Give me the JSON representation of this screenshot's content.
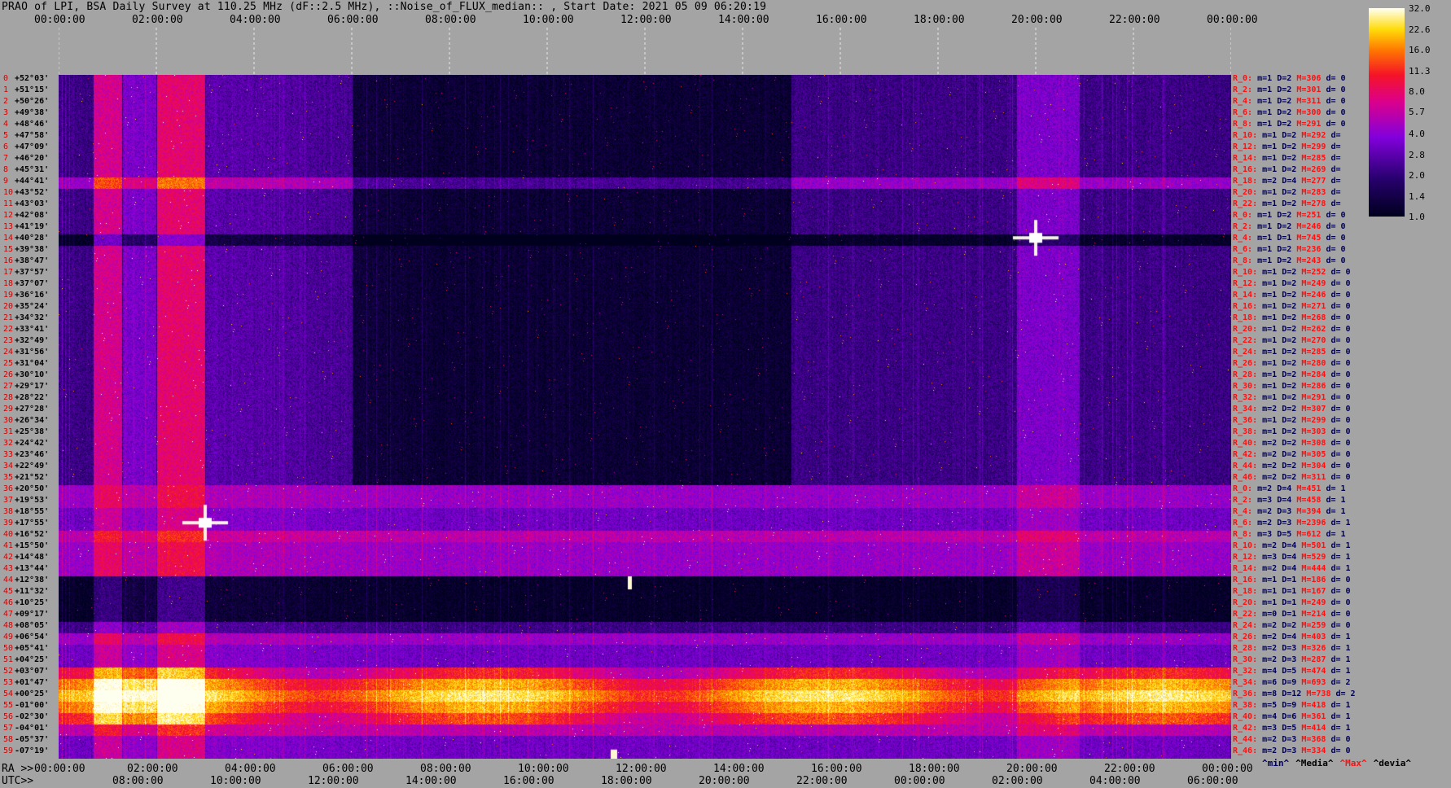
{
  "title": "PRAO of LPI, BSA Daily Survey at 110.25 MHz (dF::2.5 MHz), ::Noise_of_FLUX_median:: , Start Date: 2021 05 09 06:20:19",
  "chart_data": {
    "type": "heatmap",
    "title": "PRAO of LPI, BSA Daily Survey at 110.25 MHz (dF::2.5 MHz), ::Noise_of_FLUX_median:: , Start Date: 2021 05 09 06:20:19",
    "x_top_ticks": [
      "00:00:00",
      "02:00:00",
      "04:00:00",
      "06:00:00",
      "08:00:00",
      "10:00:00",
      "12:00:00",
      "14:00:00",
      "16:00:00",
      "18:00:00",
      "20:00:00",
      "22:00:00",
      "00:00:00"
    ],
    "x_bottom_prefix": "RA >>",
    "x_bottom_ticks": [
      "00:00:00",
      "02:00:00",
      "04:00:00",
      "06:00:00",
      "08:00:00",
      "10:00:00",
      "12:00:00",
      "14:00:00",
      "16:00:00",
      "18:00:00",
      "20:00:00",
      "22:00:00",
      "00:00:00"
    ],
    "x_utc_prefix": "UTC>>",
    "x_utc_ticks": [
      "08:00:00",
      "10:00:00",
      "12:00:00",
      "14:00:00",
      "16:00:00",
      "18:00:00",
      "20:00:00",
      "22:00:00",
      "00:00:00",
      "02:00:00",
      "04:00:00",
      "06:00:00"
    ],
    "colorbar_ticks": [
      "32.0",
      "22.6",
      "16.0",
      "11.3",
      "8.0",
      "5.7",
      "4.0",
      "2.8",
      "2.0",
      "1.4",
      "1.0"
    ],
    "colorbar_range": [
      1.0,
      32.0
    ],
    "colorbar_scale": "log",
    "stat_legend": [
      "^min^",
      "^Media^",
      "^Max^",
      "^devia^"
    ],
    "stat_legend_colors": [
      "#000055",
      "#000000",
      "#ff1010",
      "#000000"
    ],
    "beams": [
      {
        "n": "0",
        "dec": "+52°03'",
        "r": "R_0:",
        "m": "m=1",
        "d": "D=2",
        "M": "M=306",
        "dv": "d= 0"
      },
      {
        "n": "1",
        "dec": "+51°15'",
        "r": "R_2:",
        "m": "m=1",
        "d": "D=2",
        "M": "M=301",
        "dv": "d= 0"
      },
      {
        "n": "2",
        "dec": "+50°26'",
        "r": "R_4:",
        "m": "m=1",
        "d": "D=2",
        "M": "M=311",
        "dv": "d= 0"
      },
      {
        "n": "3",
        "dec": "+49°38'",
        "r": "R_6:",
        "m": "m=1",
        "d": "D=2",
        "M": "M=300",
        "dv": "d= 0"
      },
      {
        "n": "4",
        "dec": "+48°46'",
        "r": "R_8:",
        "m": "m=1",
        "d": "D=2",
        "M": "M=291",
        "dv": "d= 0"
      },
      {
        "n": "5",
        "dec": "+47°58'",
        "r": "R_10:",
        "m": "m=1",
        "d": "D=2",
        "M": "M=292",
        "dv": "d="
      },
      {
        "n": "6",
        "dec": "+47°09'",
        "r": "R_12:",
        "m": "m=1",
        "d": "D=2",
        "M": "M=299",
        "dv": "d="
      },
      {
        "n": "7",
        "dec": "+46°20'",
        "r": "R_14:",
        "m": "m=1",
        "d": "D=2",
        "M": "M=285",
        "dv": "d="
      },
      {
        "n": "8",
        "dec": "+45°31'",
        "r": "R_16:",
        "m": "m=1",
        "d": "D=2",
        "M": "M=269",
        "dv": "d="
      },
      {
        "n": "9",
        "dec": "+44°41'",
        "r": "R_18:",
        "m": "m=2",
        "d": "D=4",
        "M": "M=277",
        "dv": "d="
      },
      {
        "n": "10",
        "dec": "+43°52'",
        "r": "R_20:",
        "m": "m=1",
        "d": "D=2",
        "M": "M=283",
        "dv": "d="
      },
      {
        "n": "11",
        "dec": "+43°03'",
        "r": "R_22:",
        "m": "m=1",
        "d": "D=2",
        "M": "M=278",
        "dv": "d="
      },
      {
        "n": "12",
        "dec": "+42°08'",
        "r": "R_0:",
        "m": "m=1",
        "d": "D=2",
        "M": "M=251",
        "dv": "d= 0"
      },
      {
        "n": "13",
        "dec": "+41°19'",
        "r": "R_2:",
        "m": "m=1",
        "d": "D=2",
        "M": "M=246",
        "dv": "d= 0"
      },
      {
        "n": "14",
        "dec": "+40°28'",
        "r": "R_4:",
        "m": "m=1",
        "d": "D=1",
        "M": "M=745",
        "dv": "d= 0"
      },
      {
        "n": "15",
        "dec": "+39°38'",
        "r": "R_6:",
        "m": "m=1",
        "d": "D=2",
        "M": "M=236",
        "dv": "d= 0"
      },
      {
        "n": "16",
        "dec": "+38°47'",
        "r": "R_8:",
        "m": "m=1",
        "d": "D=2",
        "M": "M=243",
        "dv": "d= 0"
      },
      {
        "n": "17",
        "dec": "+37°57'",
        "r": "R_10:",
        "m": "m=1",
        "d": "D=2",
        "M": "M=252",
        "dv": "d= 0"
      },
      {
        "n": "18",
        "dec": "+37°07'",
        "r": "R_12:",
        "m": "m=1",
        "d": "D=2",
        "M": "M=249",
        "dv": "d= 0"
      },
      {
        "n": "19",
        "dec": "+36°16'",
        "r": "R_14:",
        "m": "m=1",
        "d": "D=2",
        "M": "M=246",
        "dv": "d= 0"
      },
      {
        "n": "20",
        "dec": "+35°24'",
        "r": "R_16:",
        "m": "m=1",
        "d": "D=2",
        "M": "M=271",
        "dv": "d= 0"
      },
      {
        "n": "21",
        "dec": "+34°32'",
        "r": "R_18:",
        "m": "m=1",
        "d": "D=2",
        "M": "M=268",
        "dv": "d= 0"
      },
      {
        "n": "22",
        "dec": "+33°41'",
        "r": "R_20:",
        "m": "m=1",
        "d": "D=2",
        "M": "M=262",
        "dv": "d= 0"
      },
      {
        "n": "23",
        "dec": "+32°49'",
        "r": "R_22:",
        "m": "m=1",
        "d": "D=2",
        "M": "M=270",
        "dv": "d= 0"
      },
      {
        "n": "24",
        "dec": "+31°56'",
        "r": "R_24:",
        "m": "m=1",
        "d": "D=2",
        "M": "M=285",
        "dv": "d= 0"
      },
      {
        "n": "25",
        "dec": "+31°04'",
        "r": "R_26:",
        "m": "m=1",
        "d": "D=2",
        "M": "M=280",
        "dv": "d= 0"
      },
      {
        "n": "26",
        "dec": "+30°10'",
        "r": "R_28:",
        "m": "m=1",
        "d": "D=2",
        "M": "M=284",
        "dv": "d= 0"
      },
      {
        "n": "27",
        "dec": "+29°17'",
        "r": "R_30:",
        "m": "m=1",
        "d": "D=2",
        "M": "M=286",
        "dv": "d= 0"
      },
      {
        "n": "28",
        "dec": "+28°22'",
        "r": "R_32:",
        "m": "m=1",
        "d": "D=2",
        "M": "M=291",
        "dv": "d= 0"
      },
      {
        "n": "29",
        "dec": "+27°28'",
        "r": "R_34:",
        "m": "m=2",
        "d": "D=2",
        "M": "M=307",
        "dv": "d= 0"
      },
      {
        "n": "30",
        "dec": "+26°34'",
        "r": "R_36:",
        "m": "m=1",
        "d": "D=2",
        "M": "M=299",
        "dv": "d= 0"
      },
      {
        "n": "31",
        "dec": "+25°38'",
        "r": "R_38:",
        "m": "m=1",
        "d": "D=2",
        "M": "M=303",
        "dv": "d= 0"
      },
      {
        "n": "32",
        "dec": "+24°42'",
        "r": "R_40:",
        "m": "m=2",
        "d": "D=2",
        "M": "M=308",
        "dv": "d= 0"
      },
      {
        "n": "33",
        "dec": "+23°46'",
        "r": "R_42:",
        "m": "m=2",
        "d": "D=2",
        "M": "M=305",
        "dv": "d= 0"
      },
      {
        "n": "34",
        "dec": "+22°49'",
        "r": "R_44:",
        "m": "m=2",
        "d": "D=2",
        "M": "M=304",
        "dv": "d= 0"
      },
      {
        "n": "35",
        "dec": "+21°52'",
        "r": "R_46:",
        "m": "m=2",
        "d": "D=2",
        "M": "M=311",
        "dv": "d= 0"
      },
      {
        "n": "36",
        "dec": "+20°50'",
        "r": "R_0:",
        "m": "m=2",
        "d": "D=4",
        "M": "M=451",
        "dv": "d= 1"
      },
      {
        "n": "37",
        "dec": "+19°53'",
        "r": "R_2:",
        "m": "m=3",
        "d": "D=4",
        "M": "M=458",
        "dv": "d= 1"
      },
      {
        "n": "38",
        "dec": "+18°55'",
        "r": "R_4:",
        "m": "m=2",
        "d": "D=3",
        "M": "M=394",
        "dv": "d= 1"
      },
      {
        "n": "39",
        "dec": "+17°55'",
        "r": "R_6:",
        "m": "m=2",
        "d": "D=3",
        "M": "M=2396",
        "dv": "d= 1"
      },
      {
        "n": "40",
        "dec": "+16°52'",
        "r": "R_8:",
        "m": "m=3",
        "d": "D=5",
        "M": "M=612",
        "dv": "d= 1"
      },
      {
        "n": "41",
        "dec": "+15°50'",
        "r": "R_10:",
        "m": "m=2",
        "d": "D=4",
        "M": "M=501",
        "dv": "d= 1"
      },
      {
        "n": "42",
        "dec": "+14°48'",
        "r": "R_12:",
        "m": "m=3",
        "d": "D=4",
        "M": "M=529",
        "dv": "d= 1"
      },
      {
        "n": "43",
        "dec": "+13°44'",
        "r": "R_14:",
        "m": "m=2",
        "d": "D=4",
        "M": "M=444",
        "dv": "d= 1"
      },
      {
        "n": "44",
        "dec": "+12°38'",
        "r": "R_16:",
        "m": "m=1",
        "d": "D=1",
        "M": "M=186",
        "dv": "d= 0"
      },
      {
        "n": "45",
        "dec": "+11°32'",
        "r": "R_18:",
        "m": "m=1",
        "d": "D=1",
        "M": "M=167",
        "dv": "d= 0"
      },
      {
        "n": "46",
        "dec": "+10°25'",
        "r": "R_20:",
        "m": "m=1",
        "d": "D=1",
        "M": "M=249",
        "dv": "d= 0"
      },
      {
        "n": "47",
        "dec": "+09°17'",
        "r": "R_22:",
        "m": "m=0",
        "d": "D=1",
        "M": "M=214",
        "dv": "d= 0"
      },
      {
        "n": "48",
        "dec": "+08°05'",
        "r": "R_24:",
        "m": "m=2",
        "d": "D=2",
        "M": "M=259",
        "dv": "d= 0"
      },
      {
        "n": "49",
        "dec": "+06°54'",
        "r": "R_26:",
        "m": "m=2",
        "d": "D=4",
        "M": "M=403",
        "dv": "d= 1"
      },
      {
        "n": "50",
        "dec": "+05°41'",
        "r": "R_28:",
        "m": "m=2",
        "d": "D=3",
        "M": "M=326",
        "dv": "d= 1"
      },
      {
        "n": "51",
        "dec": "+04°25'",
        "r": "R_30:",
        "m": "m=2",
        "d": "D=3",
        "M": "M=287",
        "dv": "d= 1"
      },
      {
        "n": "52",
        "dec": "+03°07'",
        "r": "R_32:",
        "m": "m=4",
        "d": "D=5",
        "M": "M=474",
        "dv": "d= 1"
      },
      {
        "n": "53",
        "dec": "+01°47'",
        "r": "R_34:",
        "m": "m=6",
        "d": "D=9",
        "M": "M=693",
        "dv": "d= 2"
      },
      {
        "n": "54",
        "dec": "+00°25'",
        "r": "R_36:",
        "m": "m=8",
        "d": "D=12",
        "M": "M=738",
        "dv": "d= 2"
      },
      {
        "n": "55",
        "dec": "-01°00'",
        "r": "R_38:",
        "m": "m=5",
        "d": "D=9",
        "M": "M=418",
        "dv": "d= 1"
      },
      {
        "n": "56",
        "dec": "-02°30'",
        "r": "R_40:",
        "m": "m=4",
        "d": "D=6",
        "M": "M=361",
        "dv": "d= 1"
      },
      {
        "n": "57",
        "dec": "-04°01'",
        "r": "R_42:",
        "m": "m=3",
        "d": "D=5",
        "M": "M=414",
        "dv": "d= 1"
      },
      {
        "n": "58",
        "dec": "-05°37'",
        "r": "R_44:",
        "m": "m=2",
        "d": "D=3",
        "M": "M=368",
        "dv": "d= 0"
      },
      {
        "n": "59",
        "dec": "-07°19'",
        "r": "R_46:",
        "m": "m=2",
        "d": "D=3",
        "M": "M=334",
        "dv": "d= 0"
      }
    ]
  }
}
